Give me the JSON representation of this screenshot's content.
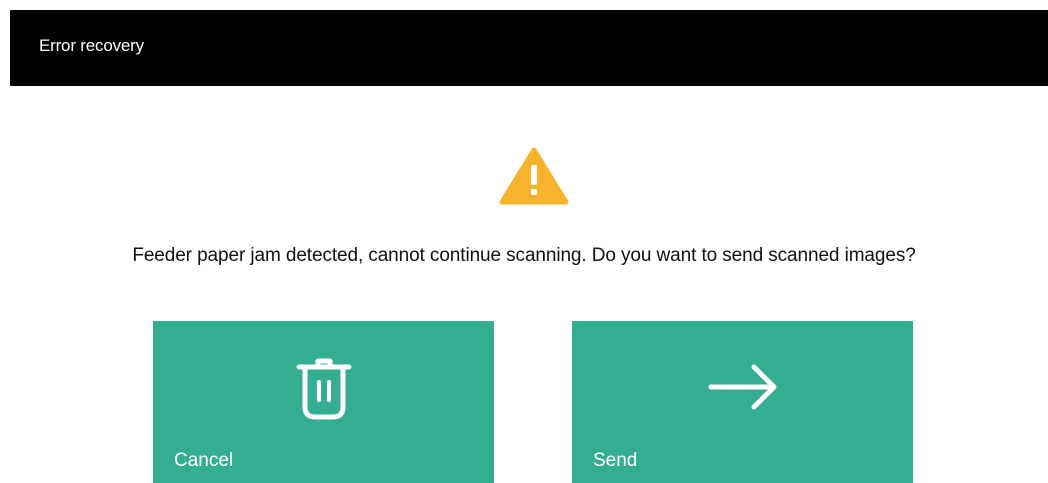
{
  "header": {
    "title": "Error recovery"
  },
  "dialog": {
    "icon": "warning-icon",
    "message": "Feeder paper jam detected, cannot continue scanning. Do you want to send scanned images?"
  },
  "actions": {
    "cancel": {
      "label": "Cancel",
      "icon": "trash-icon"
    },
    "send": {
      "label": "Send",
      "icon": "arrow-right-icon"
    }
  },
  "colors": {
    "header_bg": "#000000",
    "button_bg": "#34ae93",
    "warning": "#f7b32b"
  }
}
